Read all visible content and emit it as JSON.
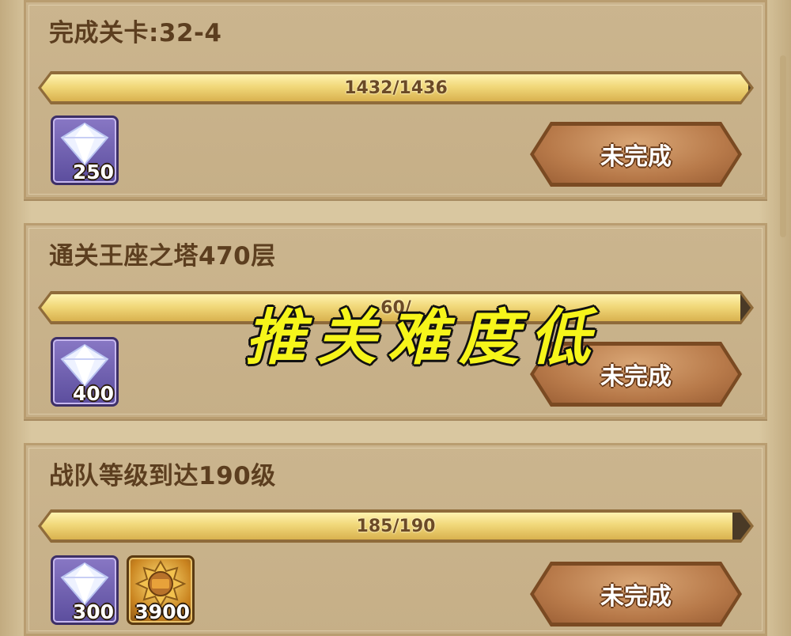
{
  "tasks": [
    {
      "title": "完成关卡:32-4",
      "progress_text": "1432/1436",
      "progress_fraction": 0.997,
      "rewards": [
        {
          "icon": "diamond-icon",
          "count": "250"
        }
      ],
      "button_label": "未完成"
    },
    {
      "title": "通关王座之塔470层",
      "progress_text": "60/",
      "progress_fraction": 0.985,
      "rewards": [
        {
          "icon": "diamond-icon",
          "count": "400"
        }
      ],
      "button_label": "未完成"
    },
    {
      "title": "战队等级到达190级",
      "progress_text": "185/190",
      "progress_fraction": 0.974,
      "rewards": [
        {
          "icon": "diamond-icon",
          "count": "300"
        },
        {
          "icon": "exp-medal-icon",
          "count": "3900"
        }
      ],
      "button_label": "未完成"
    }
  ],
  "overlay_text": "推关难度低",
  "colors": {
    "fill": "#f1d87a",
    "button": "#b87a4a",
    "overlay": "#f6f51a"
  }
}
